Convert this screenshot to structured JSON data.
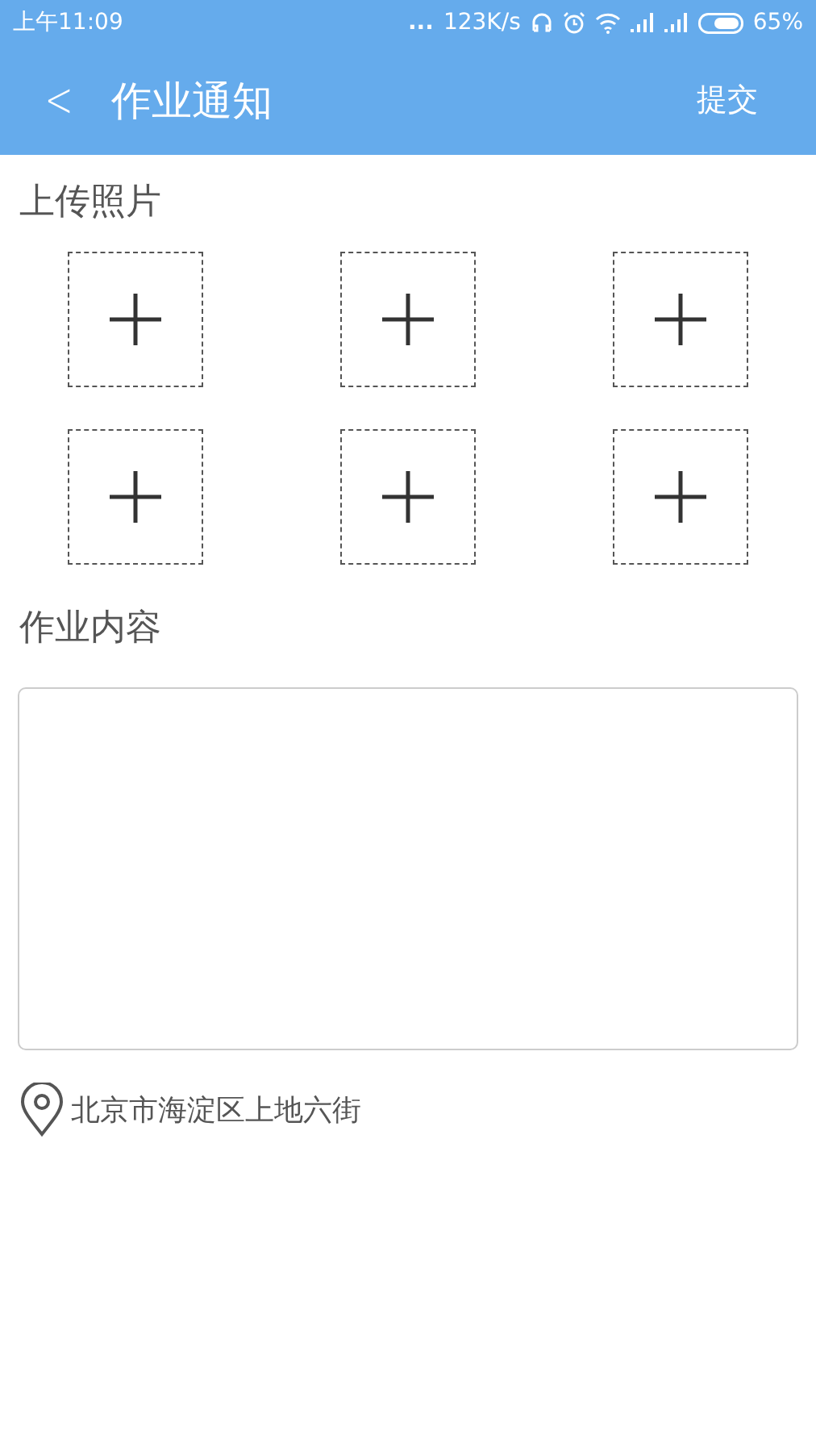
{
  "status_bar": {
    "time": "上午11:09",
    "more": "...",
    "speed": "123K/s",
    "battery": "65%"
  },
  "app_bar": {
    "back": "<",
    "title": "作业通知",
    "action": "提交"
  },
  "upload": {
    "label": "上传照片",
    "slots": [
      {
        "kind": "add"
      },
      {
        "kind": "add"
      },
      {
        "kind": "add"
      },
      {
        "kind": "add"
      },
      {
        "kind": "add"
      },
      {
        "kind": "add"
      }
    ]
  },
  "content": {
    "label": "作业内容"
  },
  "location": {
    "text": "北京市海淀区上地六街"
  }
}
